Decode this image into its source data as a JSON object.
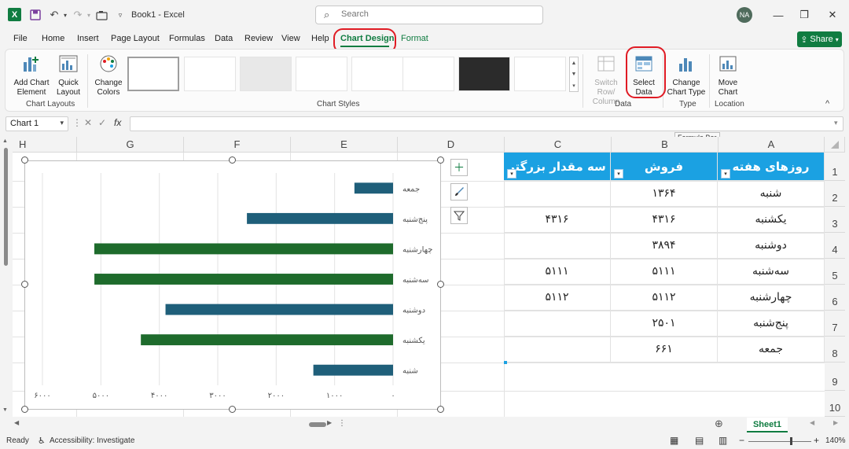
{
  "titlebar": {
    "doc_title": "Book1 - Excel",
    "search_placeholder": "Search",
    "avatar_initials": "NA",
    "icons": [
      "excel-logo",
      "save-icon",
      "undo-icon",
      "redo-icon",
      "camera-icon",
      "qat-dropdown-icon"
    ]
  },
  "menu": {
    "tabs": [
      "File",
      "Home",
      "Insert",
      "Page Layout",
      "Formulas",
      "Data",
      "Review",
      "View",
      "Help",
      "Chart Design",
      "Format"
    ],
    "active": "Chart Design",
    "share_label": "Share"
  },
  "ribbon": {
    "add_chart_element": "Add Chart\nElement",
    "quick_layout": "Quick\nLayout",
    "change_colors": "Change\nColors",
    "switch_row_column": "Switch Row/\nColumn",
    "select_data": "Select\nData",
    "change_chart_type": "Change\nChart Type",
    "move_chart": "Move\nChart",
    "groups": {
      "chart_layouts": "Chart Layouts",
      "chart_styles": "Chart Styles",
      "data": "Data",
      "type": "Type",
      "location": "Location"
    }
  },
  "formula_bar": {
    "name_box": "Chart 1",
    "fx": "fx",
    "tooltip": "Formula Bar"
  },
  "grid": {
    "columns": [
      "H",
      "G",
      "F",
      "E",
      "D",
      "C",
      "B",
      "A"
    ],
    "rows": [
      "1",
      "2",
      "3",
      "4",
      "5",
      "6",
      "7",
      "8",
      "9",
      "10"
    ],
    "table": {
      "headers": {
        "A": "روزهای هفته",
        "B": "فروش",
        "C": "سه مقدار بزرگتر"
      },
      "rows": [
        {
          "A": "شنبه",
          "B": "۱۳۶۴",
          "C": ""
        },
        {
          "A": "یکشنبه",
          "B": "۴۳۱۶",
          "C": "۴۳۱۶"
        },
        {
          "A": "دوشنبه",
          "B": "۳۸۹۴",
          "C": ""
        },
        {
          "A": "سه‌شنبه",
          "B": "۵۱۱۱",
          "C": "۵۱۱۱"
        },
        {
          "A": "چهارشنبه",
          "B": "۵۱۱۲",
          "C": "۵۱۱۲"
        },
        {
          "A": "پنج‌شنبه",
          "B": "۲۵۰۱",
          "C": ""
        },
        {
          "A": "جمعه",
          "B": "۶۶۱",
          "C": ""
        }
      ]
    }
  },
  "chart_data": {
    "type": "bar",
    "orientation": "horizontal",
    "reverse_x": true,
    "categories": [
      "جمعه",
      "پنج‌شنبه",
      "چهارشنبه",
      "سه‌شنبه",
      "دوشنبه",
      "یکشنبه",
      "شنبه"
    ],
    "values": [
      661,
      2501,
      5112,
      5111,
      3894,
      4316,
      1364
    ],
    "highlighted": [
      false,
      false,
      true,
      true,
      false,
      true,
      false
    ],
    "xlim": [
      0,
      6000
    ],
    "xticks": [
      0,
      1000,
      2000,
      3000,
      4000,
      5000,
      6000
    ],
    "xtick_labels": [
      "۰",
      "۱۰۰۰",
      "۲۰۰۰",
      "۳۰۰۰",
      "۴۰۰۰",
      "۵۰۰۰",
      "۶۰۰۰"
    ],
    "colors": {
      "normal": "#1f5f7a",
      "highlight": "#1e6b2c"
    },
    "grid": true
  },
  "sheets": {
    "active": "Sheet1"
  },
  "status": {
    "ready": "Ready",
    "accessibility": "Accessibility: Investigate",
    "zoom": "140%"
  },
  "colors": {
    "accent": "#107c41",
    "table_header": "#1ba1e2",
    "highlight_ring": "#e01b24"
  }
}
